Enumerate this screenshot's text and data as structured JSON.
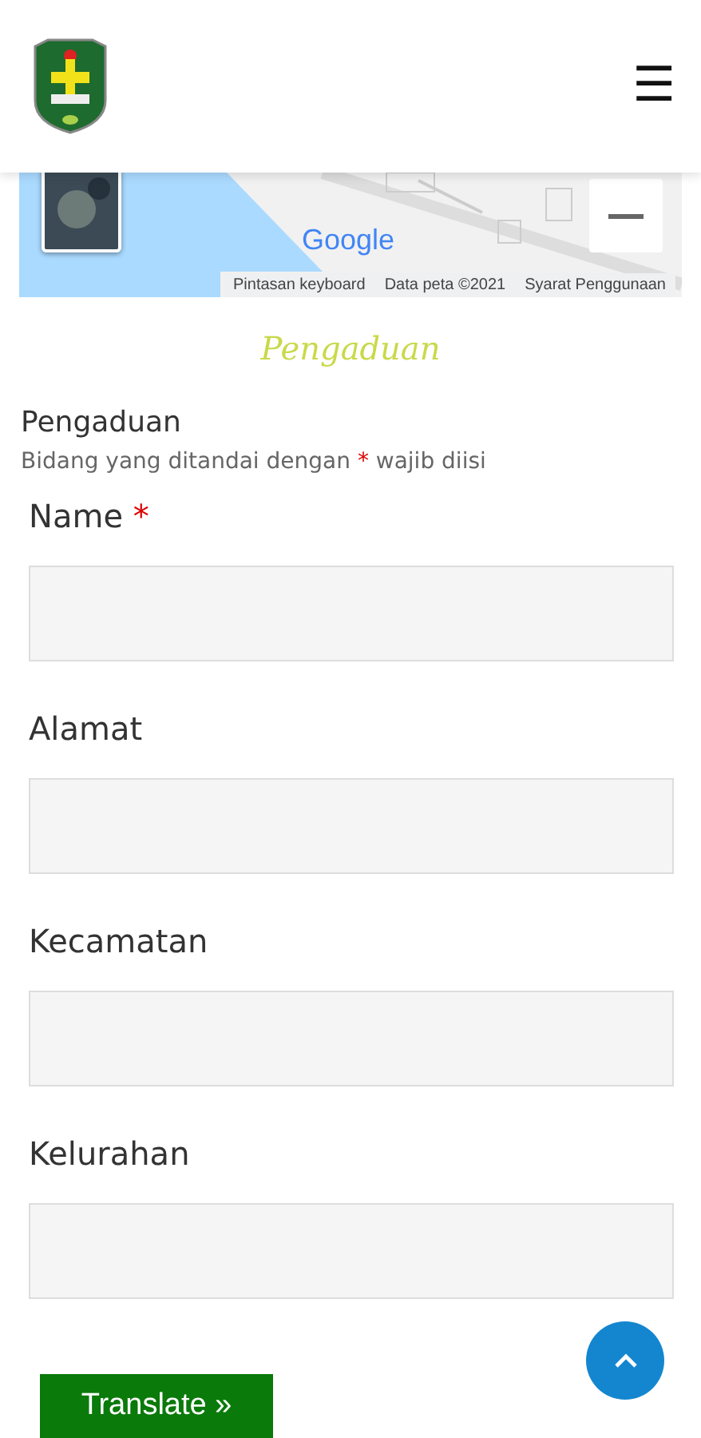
{
  "header": {
    "menu_icon": "☰"
  },
  "map": {
    "logo": "Google",
    "attribution": [
      "Pintasan keyboard",
      "Data peta ©2021",
      "Syarat Penggunaan"
    ]
  },
  "section_title": "Pengaduan",
  "form": {
    "title": "Pengaduan",
    "note": [
      "Bidang yang ditandai dengan",
      "*",
      "wajib diisi"
    ],
    "fields": [
      {
        "label": "Name",
        "required_mark": "*"
      },
      {
        "label": "Alamat"
      },
      {
        "label": "Kecamatan"
      },
      {
        "label": "Kelurahan"
      }
    ]
  },
  "translate_button": "Translate »"
}
